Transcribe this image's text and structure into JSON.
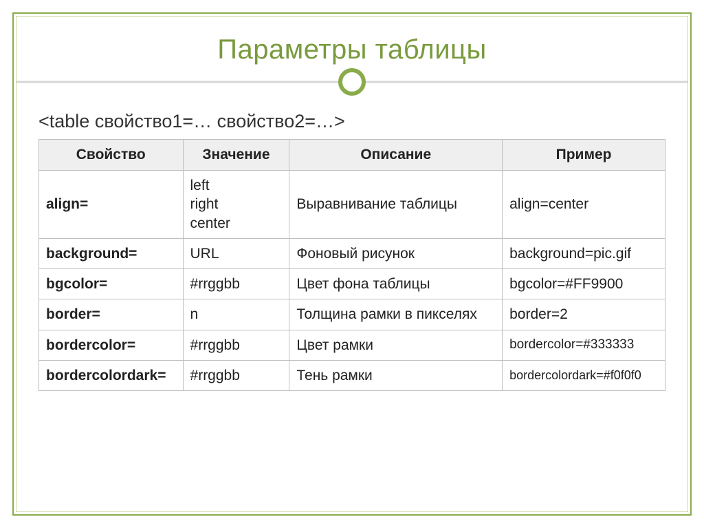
{
  "title": "Параметры таблицы",
  "syntax": "<table свойство1=… свойство2=…>",
  "headers": {
    "property": "Свойство",
    "value": "Значение",
    "description": "Описание",
    "example": "Пример"
  },
  "rows": [
    {
      "property": "align=",
      "value": "left\nright\ncenter",
      "description": "Выравнивание таблицы",
      "example": "align=center"
    },
    {
      "property": "background=",
      "value": "URL",
      "description": "Фоновый рисунок",
      "example": "background=pic.gif"
    },
    {
      "property": "bgcolor=",
      "value": "#rrggbb",
      "description": "Цвет фона таблицы",
      "example": "bgcolor=#FF9900"
    },
    {
      "property": "border=",
      "value": "n",
      "description": "Толщина рамки в пикселях",
      "example": "border=2"
    },
    {
      "property": "bordercolor=",
      "value": "#rrggbb",
      "description": "Цвет рамки",
      "example": "bordercolor=#333333"
    },
    {
      "property": "bordercolordark=",
      "value": "#rrggbb",
      "description": "Тень рамки",
      "example": "bordercolordark=#f0f0f0"
    }
  ]
}
